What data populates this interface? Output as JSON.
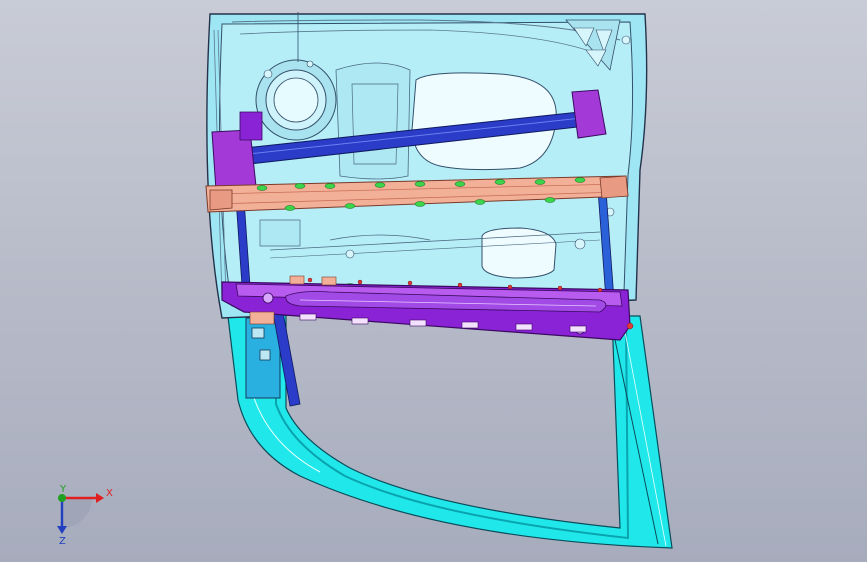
{
  "viewport": {
    "background_top": "#c9ccd6",
    "background_bottom": "#a7acbd"
  },
  "model": {
    "colors": {
      "inner_panel": "#9fe6f4",
      "panel_edge": "#23324a",
      "window_frame": "#20e8ea",
      "window_frame_dark": "#0aa3b0",
      "waist_rail": "#8a22d6",
      "waist_rail_light": "#b85cf0",
      "impact_beam": "#f2b098",
      "guide_rail": "#2a3cc8",
      "hinge_bracket": "#a33ad8",
      "sealant_dots": "#3bd44a",
      "clips": "#e03a3a"
    }
  },
  "triad": {
    "x_label": "X",
    "y_label": "Y",
    "z_label": "Z",
    "x_color": "#e02020",
    "y_color": "#20a020",
    "z_color": "#2040c0"
  }
}
